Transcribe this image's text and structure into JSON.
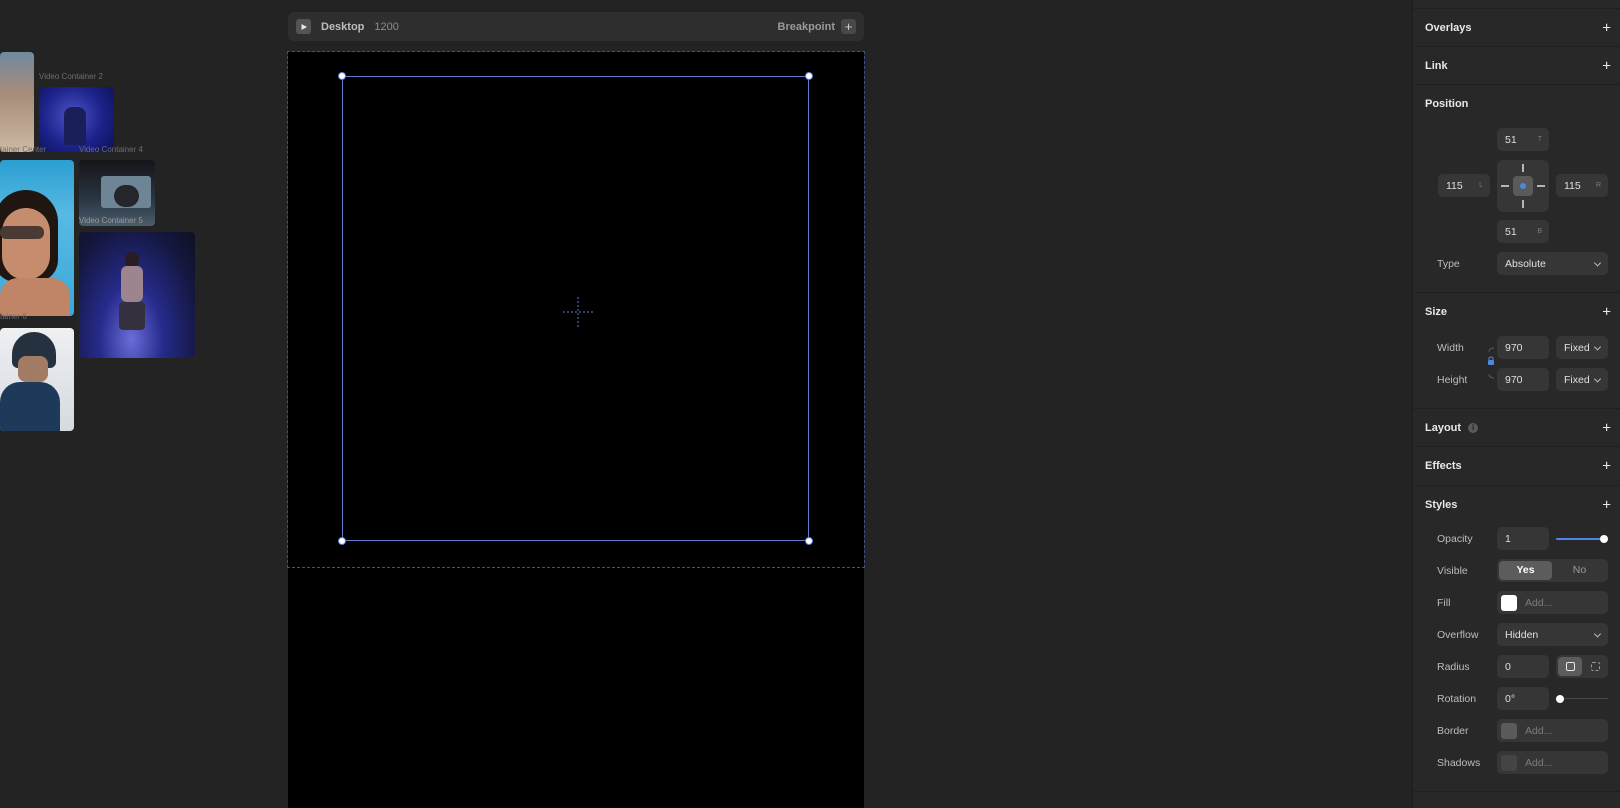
{
  "canvas": {
    "thumbnails": [
      {
        "label": "Video Container 2"
      },
      {
        "label": "tainer Center"
      },
      {
        "label": "Video Container 4"
      },
      {
        "label": "Video Container 5"
      },
      {
        "label": "tainer 6"
      }
    ]
  },
  "breakpoint_bar": {
    "name": "Desktop",
    "width": "1200",
    "breakpoint_label": "Breakpoint",
    "add": "+"
  },
  "panel": {
    "overlays": {
      "title": "Overlays"
    },
    "link": {
      "title": "Link"
    },
    "position": {
      "title": "Position",
      "top": {
        "value": "51",
        "suffix": "T"
      },
      "left": {
        "value": "115",
        "suffix": "L"
      },
      "right": {
        "value": "115",
        "suffix": "R"
      },
      "bottom": {
        "value": "51",
        "suffix": "B"
      },
      "type_label": "Type",
      "type_value": "Absolute"
    },
    "size": {
      "title": "Size",
      "width_label": "Width",
      "width_value": "970",
      "width_mode": "Fixed",
      "height_label": "Height",
      "height_value": "970",
      "height_mode": "Fixed"
    },
    "layout": {
      "title": "Layout"
    },
    "effects": {
      "title": "Effects"
    },
    "styles": {
      "title": "Styles",
      "opacity_label": "Opacity",
      "opacity_value": "1",
      "opacity_level": 1.0,
      "visible_label": "Visible",
      "visible_yes": "Yes",
      "visible_no": "No",
      "fill_label": "Fill",
      "fill_placeholder": "Add...",
      "fill_color": "#ffffff",
      "overflow_label": "Overflow",
      "overflow_value": "Hidden",
      "radius_label": "Radius",
      "radius_value": "0",
      "rotation_label": "Rotation",
      "rotation_value": "0°",
      "border_label": "Border",
      "border_placeholder": "Add...",
      "shadows_label": "Shadows",
      "shadows_placeholder": "Add..."
    },
    "plus": "+"
  },
  "colors": {
    "accent": "#4f86e0",
    "selection": "#5f7ad0"
  }
}
